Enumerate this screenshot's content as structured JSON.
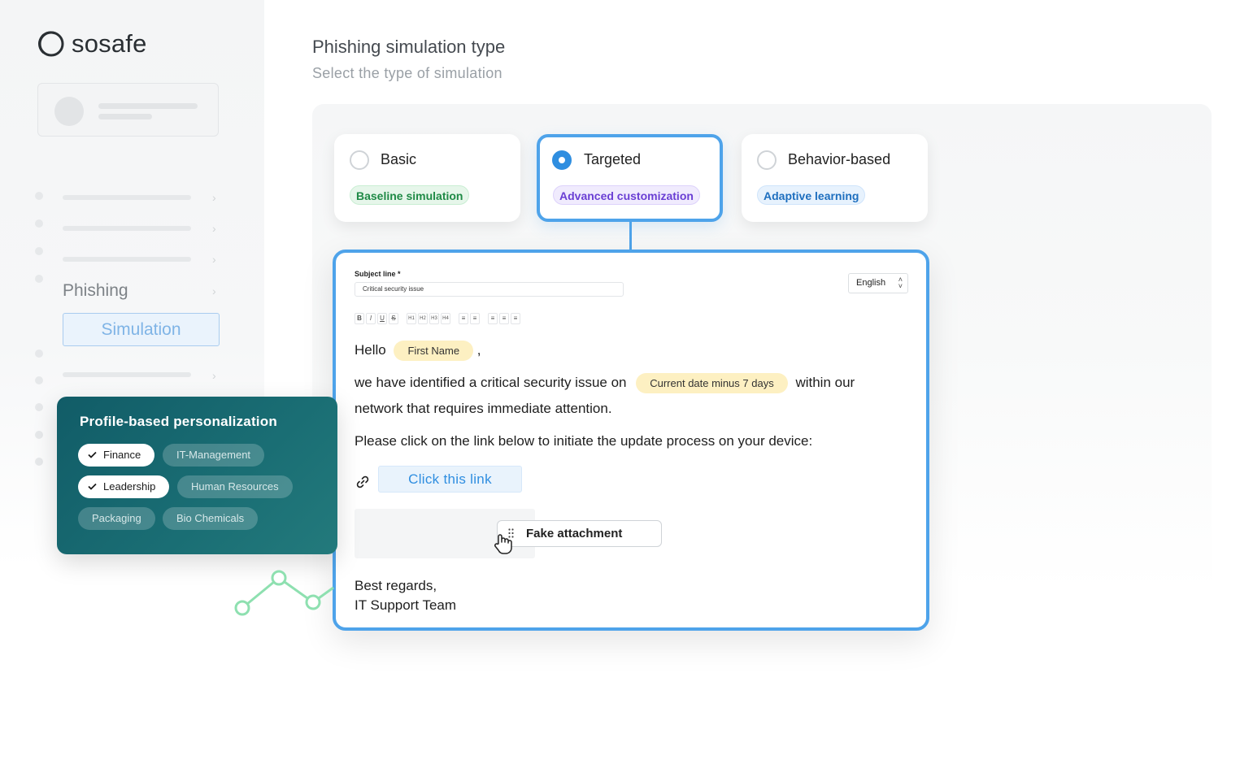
{
  "brand": {
    "name": "sosafe"
  },
  "sidebar": {
    "phishing_label": "Phishing",
    "simulation_label": "Simulation"
  },
  "header": {
    "title": "Phishing simulation type",
    "subtitle": "Select the type of simulation"
  },
  "options": [
    {
      "label": "Basic",
      "badge": "Baseline simulation",
      "selected": false
    },
    {
      "label": "Targeted",
      "badge": "Advanced customization",
      "selected": true
    },
    {
      "label": "Behavior-based",
      "badge": "Adaptive learning",
      "selected": false
    }
  ],
  "editor": {
    "subject_label": "Subject line *",
    "subject_value": "Critical security issue",
    "language": "English",
    "toolbar": [
      "B",
      "I",
      "U",
      "S",
      "H1",
      "H2",
      "H3",
      "H4"
    ],
    "greeting": "Hello",
    "first_name_var": "First Name",
    "comma": ",",
    "line1_a": "we have identified a critical security issue on",
    "date_var": "Current date minus 7 days",
    "line1_b": "within our",
    "line2": "network that requires immediate attention.",
    "line3": "Please click on the link below to initiate the update process on your device:",
    "link_text": "Click this link",
    "attachment": "Fake attachment",
    "signoff1": "Best regards,",
    "signoff2": "IT Support Team"
  },
  "personalization": {
    "title": "Profile-based personalization",
    "tags": [
      {
        "label": "Finance",
        "selected": true
      },
      {
        "label": "IT-Management",
        "selected": false
      },
      {
        "label": "Leadership",
        "selected": true
      },
      {
        "label": "Human Resources",
        "selected": false
      },
      {
        "label": "Packaging",
        "selected": false
      },
      {
        "label": "Bio Chemicals",
        "selected": false
      }
    ]
  },
  "colors": {
    "accent": "#4ea3ea",
    "teal": "#1a6e74",
    "green_badge": "#1f8a46",
    "purple_badge": "#6a3fd4",
    "blue_badge": "#1e6fbf",
    "variable_bg": "#fdf0c2"
  }
}
